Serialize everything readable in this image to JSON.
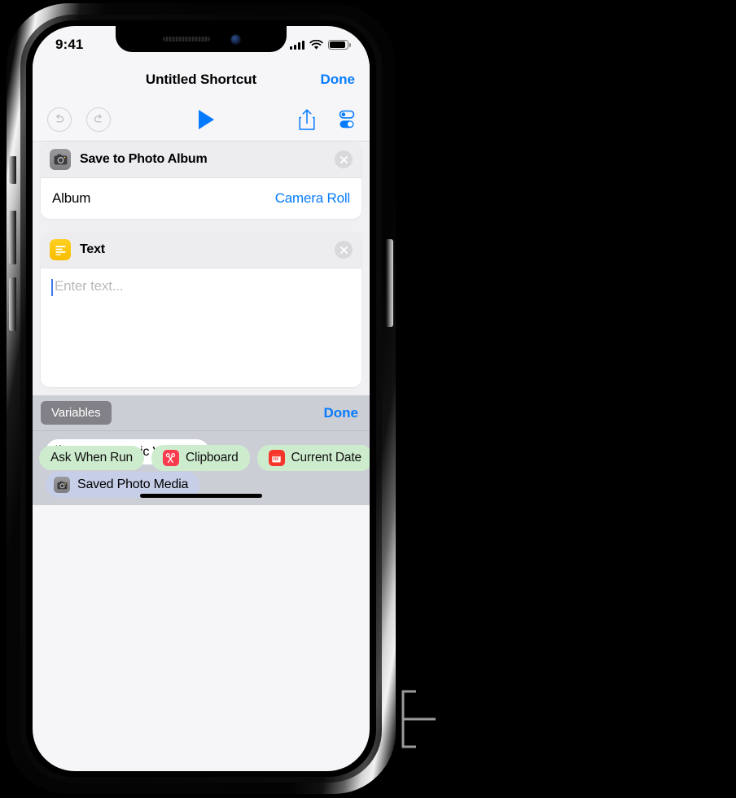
{
  "status_bar": {
    "time": "9:41",
    "cellular_icon": "signal-bars-icon",
    "wifi_icon": "wifi-icon",
    "battery_icon": "battery-icon"
  },
  "nav_bar": {
    "title": "Untitled Shortcut",
    "done_label": "Done"
  },
  "toolbar": {
    "undo_icon": "undo-icon",
    "redo_icon": "redo-icon",
    "play_icon": "play-icon",
    "share_icon": "share-icon",
    "settings_icon": "toggles-icon"
  },
  "actions": [
    {
      "icon": "camera-icon",
      "title": "Save to Photo Album",
      "close_icon": "close-circle-icon",
      "rows": [
        {
          "label": "Album",
          "value": "Camera Roll"
        }
      ]
    },
    {
      "icon": "text-lines-icon",
      "title": "Text",
      "close_icon": "close-circle-icon",
      "placeholder": "Enter text...",
      "value": ""
    }
  ],
  "variables_panel": {
    "tab_label": "Variables",
    "done_label": "Done",
    "items": [
      {
        "label": "Select Magic Variable",
        "icon": "magic-wand-icon",
        "style": "white"
      },
      {
        "label": "Saved Photo Media",
        "icon": "camera-icon",
        "style": "lavender"
      }
    ]
  },
  "suggestions": [
    {
      "label": "Ask When Run",
      "icon": null
    },
    {
      "label": "Clipboard",
      "icon": "scissors-icon"
    },
    {
      "label": "Current Date",
      "icon": "calendar-icon"
    }
  ],
  "colors": {
    "accent_blue": "#067cfd",
    "panel_gray": "#ccced6",
    "suggestion_green": "#cdeccd",
    "variable_lavender": "#c7cfe8",
    "text_action_yellow": "#f7bd00",
    "clipboard_red": "#fa3b4d",
    "calendar_red": "#f6362b"
  }
}
